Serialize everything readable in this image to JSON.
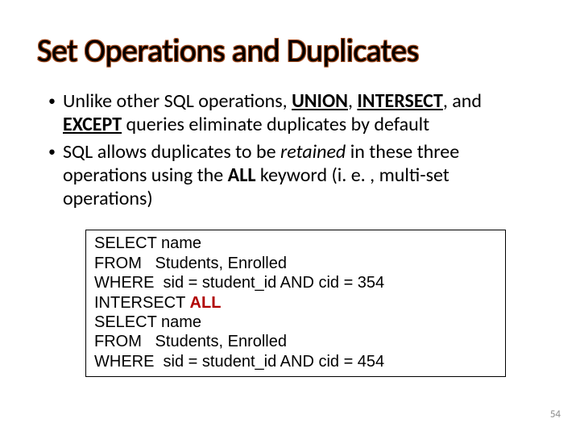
{
  "title": "Set Operations and Duplicates",
  "bullets": [
    {
      "pre": "Unlike other SQL operations, ",
      "k1": "UNION",
      "sep1": ", ",
      "k2": "INTERSECT",
      "sep2": ", and ",
      "k3": "EXCEPT",
      "post": " queries eliminate duplicates by default"
    },
    {
      "pre": "SQL allows duplicates to be ",
      "em": "retained",
      "mid": " in these three operations using the ",
      "kw": "ALL",
      "post": " keyword (i. e. , multi-set operations)"
    }
  ],
  "code": {
    "l1a": "SELECT name",
    "l2a": "FROM   Students, Enrolled",
    "l3a": "WHERE  sid = student_id AND cid = 354",
    "l4pre": "INTERSECT ",
    "l4kw": "ALL",
    "l5a": "SELECT name",
    "l6a": "FROM   Students, Enrolled",
    "l7a": "WHERE  sid = student_id AND cid = 454"
  },
  "page": "54"
}
